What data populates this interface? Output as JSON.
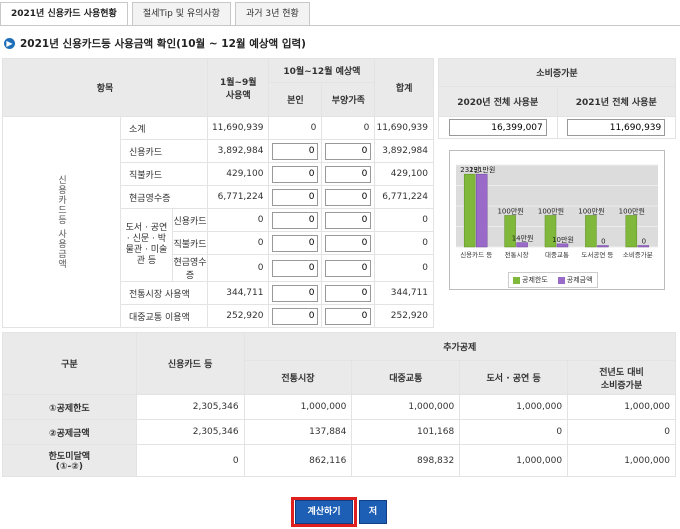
{
  "tabs": [
    "2021년 신용카드 사용현황",
    "절세Tip 및 유의사항",
    "과거 3년 현황"
  ],
  "section_title": "2021년 신용카드등 사용금액 확인(10월 ~ 12월 예상액 입력)",
  "usage": {
    "headers": {
      "item": "항목",
      "jan_sep": "1월~9월\n사용액",
      "oct_dec": "10월~12월 예상액",
      "self": "본인",
      "dependent": "부양가족",
      "total": "합계"
    },
    "side_label": "신용카드등 사용금액",
    "rows": [
      {
        "label": "소계",
        "jan_sep": "11,690,939",
        "self": "0",
        "dep": "0",
        "total": "11,690,939",
        "input": false
      },
      {
        "label": "신용카드",
        "jan_sep": "3,892,984",
        "self": "0",
        "dep": "0",
        "total": "3,892,984",
        "input": true
      },
      {
        "label": "직불카드",
        "jan_sep": "429,100",
        "self": "0",
        "dep": "0",
        "total": "429,100",
        "input": true
      },
      {
        "label": "현금영수증",
        "jan_sep": "6,771,224",
        "self": "0",
        "dep": "0",
        "total": "6,771,224",
        "input": true
      }
    ],
    "culture_label": "도서 · 공연 · 신문 · 박물관 · 미술관 등",
    "culture_rows": [
      {
        "label": "신용카드",
        "jan_sep": "0",
        "self": "0",
        "dep": "0",
        "total": "0"
      },
      {
        "label": "직불카드",
        "jan_sep": "0",
        "self": "0",
        "dep": "0",
        "total": "0"
      },
      {
        "label": "현금영수증",
        "jan_sep": "0",
        "self": "0",
        "dep": "0",
        "total": "0"
      }
    ],
    "tail_rows": [
      {
        "label": "전통시장 사용액",
        "jan_sep": "344,711",
        "self": "0",
        "dep": "0",
        "total": "344,711"
      },
      {
        "label": "대중교통 이용액",
        "jan_sep": "252,920",
        "self": "0",
        "dep": "0",
        "total": "252,920"
      }
    ]
  },
  "increase": {
    "title": "소비증가분",
    "col2020": "2020년 전체 사용분",
    "col2021": "2021년 전체 사용분",
    "val2020": "16,399,007",
    "val2021": "11,690,939"
  },
  "chart_data": {
    "type": "bar",
    "categories": [
      "신용카드 등",
      "전통시장",
      "대중교통",
      "도서공연 등",
      "소비증가분"
    ],
    "series": [
      {
        "name": "공제한도",
        "values": [
          231,
          100,
          100,
          100,
          100
        ],
        "color": "#7fb83a"
      },
      {
        "name": "공제금액",
        "values": [
          231,
          14,
          10,
          0,
          0
        ],
        "color": "#9a6ac8"
      }
    ],
    "data_labels": [
      [
        "231만",
        "100만원",
        "100만원",
        "100만원",
        "100만원"
      ],
      [
        "231만원",
        "14만원",
        "10만원",
        "0",
        "0"
      ]
    ],
    "ylim": [
      0,
      260
    ],
    "grid": true,
    "legend_position": "bottom"
  },
  "deduction": {
    "headers": {
      "category": "구분",
      "credit": "신용카드 등",
      "additional": "추가공제",
      "market": "전통시장",
      "transit": "대중교통",
      "culture": "도서 · 공연 등",
      "increase": "전년도 대비\n소비증가분"
    },
    "rows": [
      {
        "label": "①공제한도",
        "values": [
          "2,305,346",
          "1,000,000",
          "1,000,000",
          "1,000,000",
          "1,000,000"
        ]
      },
      {
        "label": "②공제금액",
        "values": [
          "2,305,346",
          "137,884",
          "101,168",
          "0",
          "0"
        ]
      },
      {
        "label": "한도미달액\n(①-②)",
        "values": [
          "0",
          "862,116",
          "898,832",
          "1,000,000",
          "1,000,000"
        ]
      }
    ]
  },
  "buttons": {
    "calc": "계산하기",
    "save": "저장"
  },
  "colors": {
    "accent": "#1d5fb5",
    "highlight": "#e0201e",
    "header_bg": "#eaeaea"
  }
}
